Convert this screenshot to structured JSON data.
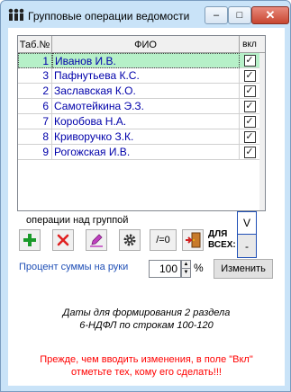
{
  "window": {
    "title": "Групповые операции ведомости",
    "minimize_symbol": "–",
    "maximize_symbol": "□",
    "close_symbol": "✕"
  },
  "grid": {
    "headers": {
      "tab": "Таб.№",
      "fio": "ФИО",
      "vkl": "вкл"
    },
    "rows": [
      {
        "tab": "1",
        "fio": "Иванов И.В.",
        "checked": true,
        "selected": true
      },
      {
        "tab": "3",
        "fio": "Пафнутьева К.С.",
        "checked": true,
        "selected": false
      },
      {
        "tab": "2",
        "fio": "Заславская К.О.",
        "checked": true,
        "selected": false
      },
      {
        "tab": "6",
        "fio": "Самотейкина Э.З.",
        "checked": true,
        "selected": false
      },
      {
        "tab": "7",
        "fio": "Коробова Н.А.",
        "checked": true,
        "selected": false
      },
      {
        "tab": "8",
        "fio": "Криворучко З.К.",
        "checked": true,
        "selected": false
      },
      {
        "tab": "9",
        "fio": "Рогожская И.В.",
        "checked": true,
        "selected": false
      }
    ]
  },
  "group_ops": {
    "label": "операции над группой",
    "zero_button": "/=0",
    "for_all_label": "ДЛЯ ВСЕХ:",
    "check_all": "V",
    "uncheck_all": "-",
    "icons": [
      "plus-icon",
      "delete-icon",
      "pencil-icon",
      "gear-icon",
      "exit-door-icon"
    ]
  },
  "percent": {
    "label": "Процент суммы на руки",
    "value": "100",
    "sign": "%",
    "change_button": "Изменить"
  },
  "dates_note": {
    "line1": "Даты для формирования 2  раздела",
    "line2": "6-НДФЛ по строкам  100-120"
  },
  "warning": {
    "line1": "Прежде, чем вводить изменения, в поле \"Вкл\"",
    "line2": "отметьте тех, кому его сделать!!!"
  },
  "colors": {
    "accent_blue": "#1f4fb6",
    "row_text": "#0000aa",
    "selected_row": "#b6f0c8",
    "warning_red": "#ff0000",
    "add_green": "#1a9a2a",
    "delete_red": "#e02020",
    "edit_purple": "#c040c0"
  }
}
